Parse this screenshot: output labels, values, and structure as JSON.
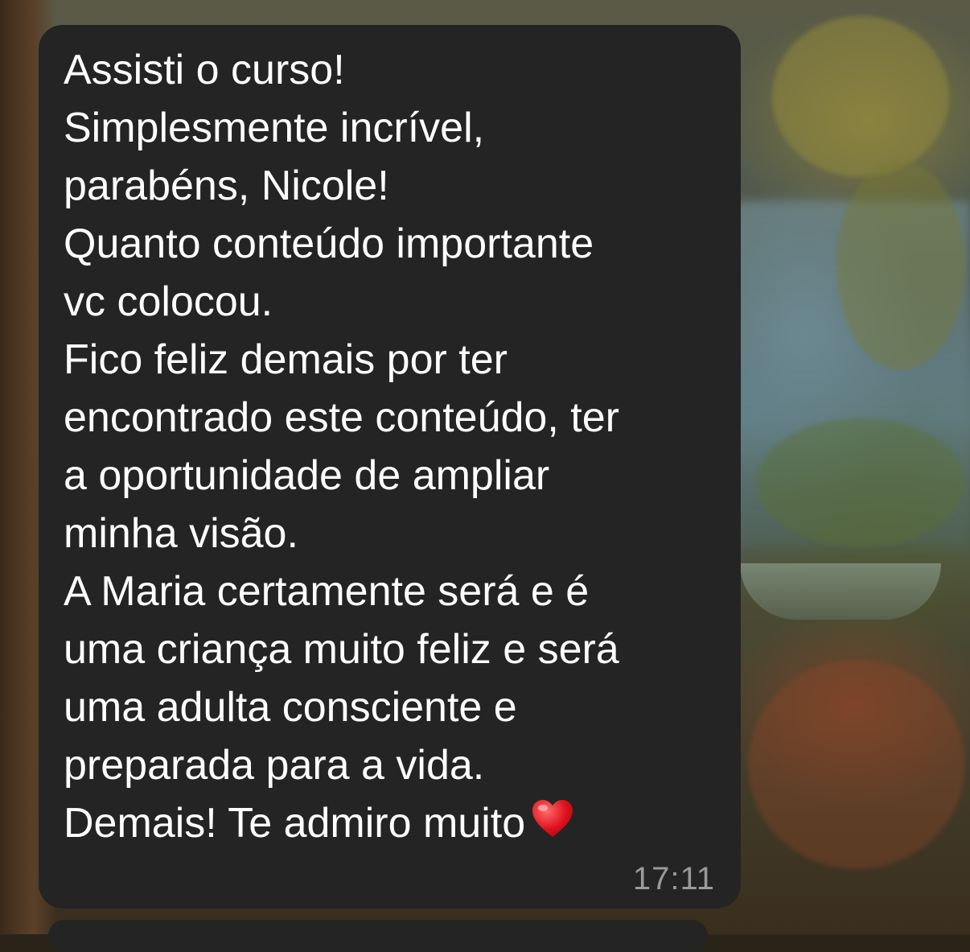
{
  "message": {
    "lines": [
      "Assisti o curso!",
      "Simplesmente incrível,",
      "parabéns, Nicole!",
      "Quanto conteúdo importante",
      "vc colocou.",
      "Fico feliz demais por ter",
      "encontrado este conteúdo, ter",
      "a oportunidade de ampliar",
      "minha visão.",
      "A Maria certamente será e é",
      "uma criança muito feliz e será",
      "uma adulta consciente e",
      "preparada para a vida.",
      "Demais! Te admiro muito"
    ],
    "emoji": "heart-icon",
    "time": "17:11"
  },
  "colors": {
    "bubble": "#242424",
    "text": "#ffffff",
    "timestamp": "#9a9a9a",
    "heart": "#e0121e"
  }
}
